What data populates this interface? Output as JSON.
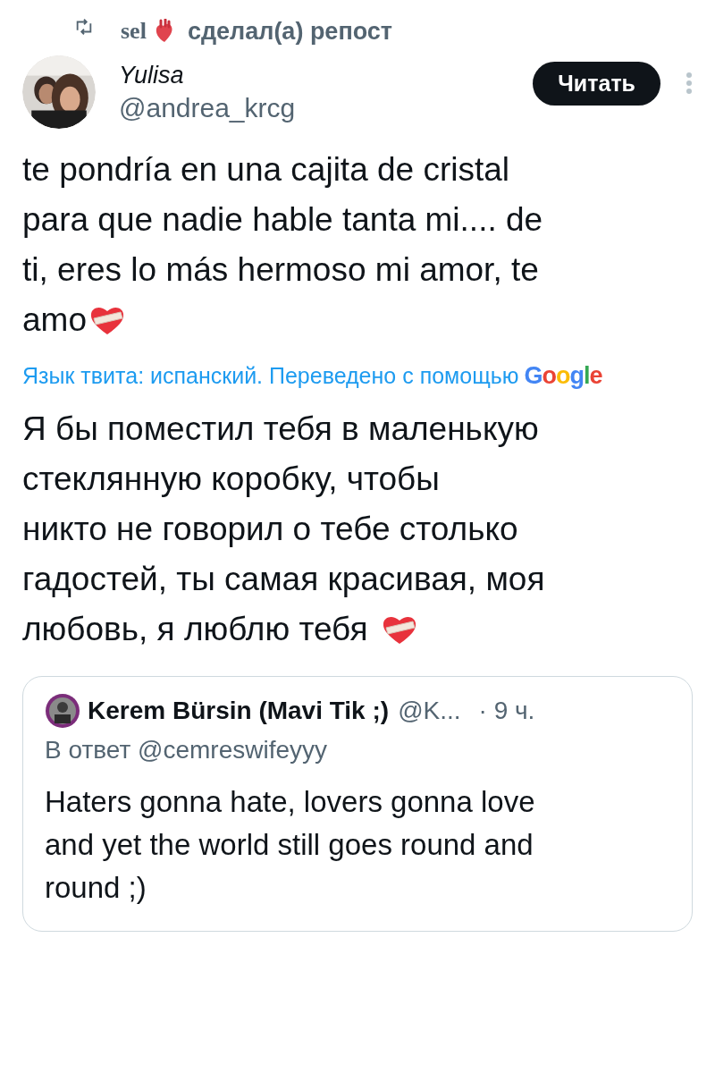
{
  "repost": {
    "user": "sel",
    "action": "сделал(а) репост"
  },
  "author": {
    "name": "Yulisa",
    "handle": "@andrea_krcg"
  },
  "follow_button": "Читать",
  "tweet_lines": [
    "te pondría en una cajita de cristal",
    "para que nadie hable tanta mi.... de",
    "ti, eres lo más hermoso mi amor, te",
    "amo"
  ],
  "translation_note": {
    "text": "Язык твита: испанский. Переведено с помощью",
    "logo": "Google"
  },
  "translated_lines": [
    "Я бы поместил тебя в маленькую",
    "стеклянную коробку, чтобы",
    "никто не говорил о тебе столько",
    "гадостей, ты самая красивая, моя",
    "любовь, я люблю тебя"
  ],
  "quote": {
    "name": "Kerem Bürsin (Mavi Tik ;)",
    "handle": "@K...",
    "time": "· 9 ч.",
    "reply_to": "В ответ @cemreswifeyyy",
    "text": "Haters gonna hate, lovers gonna love and yet the world still goes round and round ;)"
  }
}
